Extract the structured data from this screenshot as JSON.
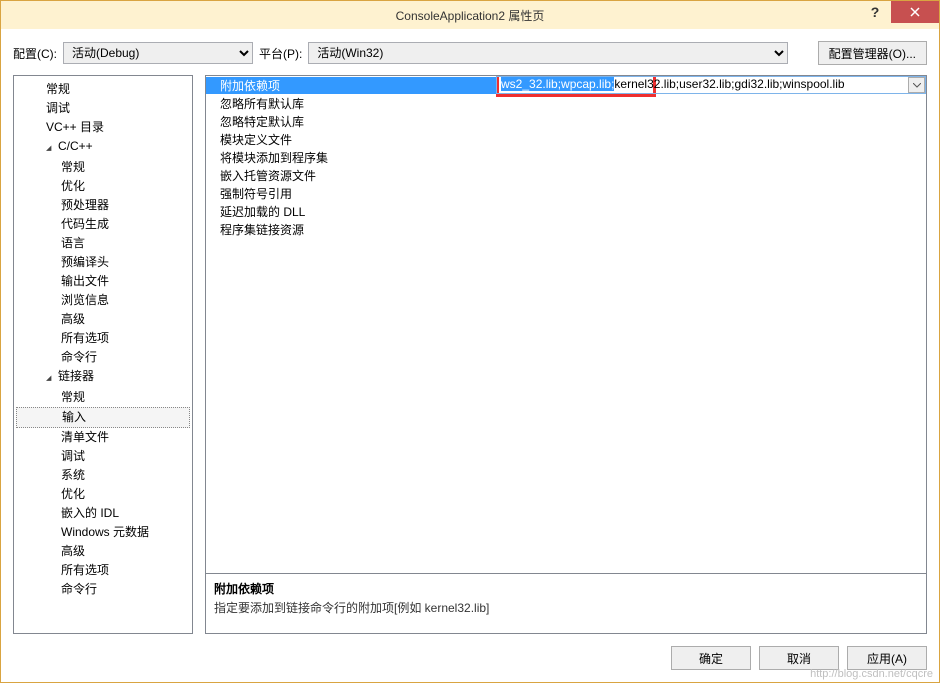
{
  "title": "ConsoleApplication2 属性页",
  "toprow": {
    "config_label": "配置(C):",
    "config_value": "活动(Debug)",
    "platform_label": "平台(P):",
    "platform_value": "活动(Win32)",
    "manager_btn": "配置管理器(O)..."
  },
  "tree": [
    {
      "label": "常规",
      "level": 2
    },
    {
      "label": "调试",
      "level": 2
    },
    {
      "label": "VC++ 目录",
      "level": 2
    },
    {
      "label": "C/C++",
      "level": 2,
      "expandable": true,
      "expanded": true
    },
    {
      "label": "常规",
      "level": 3
    },
    {
      "label": "优化",
      "level": 3
    },
    {
      "label": "预处理器",
      "level": 3
    },
    {
      "label": "代码生成",
      "level": 3
    },
    {
      "label": "语言",
      "level": 3
    },
    {
      "label": "预编译头",
      "level": 3
    },
    {
      "label": "输出文件",
      "level": 3
    },
    {
      "label": "浏览信息",
      "level": 3
    },
    {
      "label": "高级",
      "level": 3
    },
    {
      "label": "所有选项",
      "level": 3
    },
    {
      "label": "命令行",
      "level": 3
    },
    {
      "label": "链接器",
      "level": 2,
      "expandable": true,
      "expanded": true
    },
    {
      "label": "常规",
      "level": 3
    },
    {
      "label": "输入",
      "level": 3,
      "selected": true
    },
    {
      "label": "清单文件",
      "level": 3
    },
    {
      "label": "调试",
      "level": 3
    },
    {
      "label": "系统",
      "level": 3
    },
    {
      "label": "优化",
      "level": 3
    },
    {
      "label": "嵌入的 IDL",
      "level": 3
    },
    {
      "label": "Windows 元数据",
      "level": 3
    },
    {
      "label": "高级",
      "level": 3
    },
    {
      "label": "所有选项",
      "level": 3
    },
    {
      "label": "命令行",
      "level": 3
    }
  ],
  "props": [
    {
      "label": "附加依赖项",
      "value_hl": "ws2_32.lib;wpcap.lib;",
      "value_rest": "kernel32.lib;user32.lib;gdi32.lib;winspool.lib",
      "selected": true
    },
    {
      "label": "忽略所有默认库"
    },
    {
      "label": "忽略特定默认库"
    },
    {
      "label": "模块定义文件"
    },
    {
      "label": "将模块添加到程序集"
    },
    {
      "label": "嵌入托管资源文件"
    },
    {
      "label": "强制符号引用"
    },
    {
      "label": "延迟加载的 DLL"
    },
    {
      "label": "程序集链接资源"
    }
  ],
  "desc": {
    "title": "附加依赖项",
    "text": "指定要添加到链接命令行的附加项[例如 kernel32.lib]"
  },
  "buttons": {
    "ok": "确定",
    "cancel": "取消",
    "apply": "应用(A)"
  },
  "watermark": "http://blog.csdn.net/cqcre"
}
